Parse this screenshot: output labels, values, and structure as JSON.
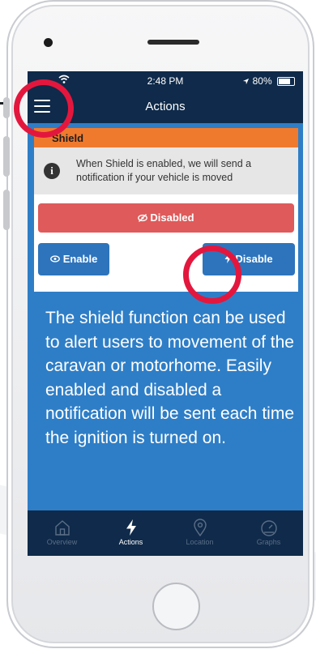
{
  "status_bar": {
    "time": "2:48 PM",
    "battery": "80%"
  },
  "nav": {
    "title": "Actions"
  },
  "shield": {
    "header": "Shield",
    "info": "When Shield is enabled, we will send a notification if your vehicle is moved",
    "status_label": "Disabled",
    "enable_label": "Enable",
    "disable_label": "Disable"
  },
  "overlay_caption": "The shield function can be used to alert  users to movement of the caravan or motorhome. Easily enabled and disabled a notification will be sent each time the ignition is turned on.",
  "tabs": [
    {
      "label": "Overview",
      "icon": "home-icon",
      "active": false
    },
    {
      "label": "Actions",
      "icon": "lightning-icon",
      "active": true
    },
    {
      "label": "Location",
      "icon": "location-pin-icon",
      "active": false
    },
    {
      "label": "Graphs",
      "icon": "gauge-icon",
      "active": false
    }
  ],
  "colors": {
    "app_blue": "#2e7ec7",
    "nav_dark": "#0f2a4a",
    "shield_orange": "#ef7a2e",
    "disabled_red": "#df5a5a",
    "button_blue": "#2d74bc",
    "highlight_red": "#e3173d"
  }
}
